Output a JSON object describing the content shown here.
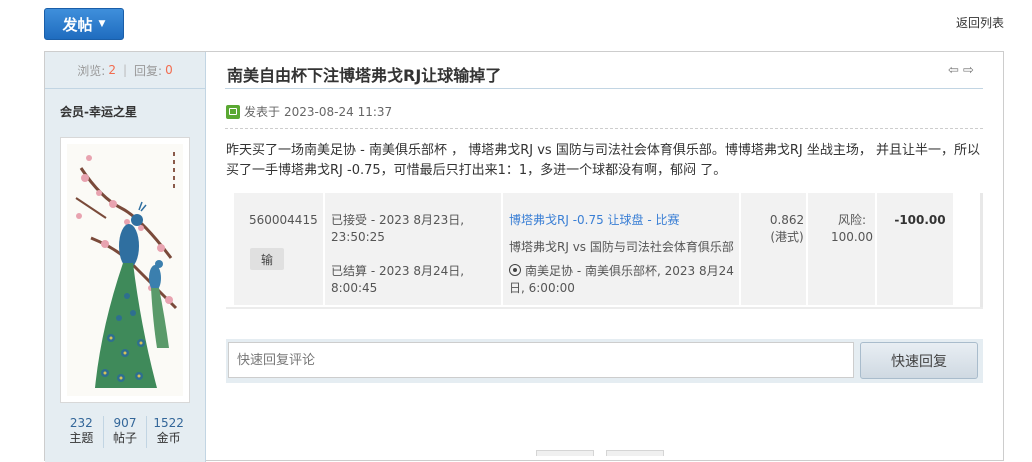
{
  "toolbar": {
    "post_label": "发帖",
    "back_label": "返回列表"
  },
  "sidebar": {
    "views_label": "浏览:",
    "views_count": "2",
    "replies_label": "回复:",
    "replies_count": "0",
    "username": "会员-幸运之星",
    "avatar_icon": "peacock-painting",
    "stats": [
      {
        "value": "232",
        "label": "主题"
      },
      {
        "value": "907",
        "label": "帖子"
      },
      {
        "value": "1522",
        "label": "金币"
      }
    ]
  },
  "thread": {
    "title": "南美自由杯下注博塔弗戈RJ让球输掉了",
    "posted_label": "发表于",
    "posted_time": "2023-08-24 11:37",
    "body": "昨天买了一场南美足协 - 南美俱乐部杯 ， 博塔弗戈RJ vs 国防与司法社会体育俱乐部。博博塔弗戈RJ 坐战主场， 并且让半一，所以买了一手博塔弗戈RJ -0.75，可惜最后只打出来1：1，多进一个球都没有啊，郁闷 了。"
  },
  "bet": {
    "id": "560004415",
    "status": "输",
    "accepted": "已接受 - 2023 8月23日, 23:50:25",
    "settled": "已结算 - 2023 8月24日, 8:00:45",
    "market": "博塔弗戈RJ -0.75 让球盘 - 比赛",
    "teams": "博塔弗戈RJ vs 国防与司法社会体育俱乐部",
    "event": "南美足协 - 南美俱乐部杯, 2023 8月24日, 6:00:00",
    "odds": "0.862",
    "odds_type": "(港式)",
    "risk_label": "风险:",
    "risk_value": "100.00",
    "result": "-100.00"
  },
  "reply": {
    "placeholder": "快速回复评论",
    "button_label": "快速回复"
  },
  "colors": {
    "accent": "#1f6cbf",
    "sidebar_bg": "#e5edf2",
    "highlight": "#f26c4f",
    "link": "#3a7fd5"
  }
}
